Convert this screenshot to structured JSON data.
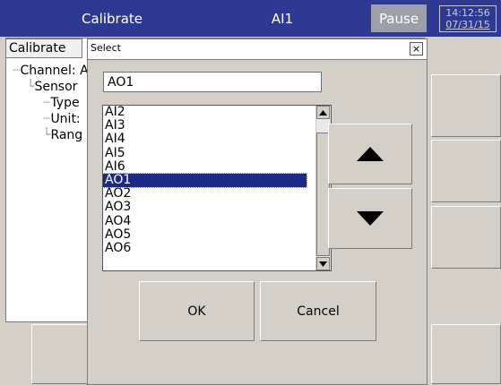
{
  "header": {
    "title": "Calibrate",
    "channel": "AI1",
    "status": "Pause",
    "time": "14:12:56",
    "date": "07/31/15",
    "background": "#2e3a92"
  },
  "tabs": {
    "calibrate": "Calibrate"
  },
  "tree": {
    "channel": "Channel: A",
    "sensor": "Sensor",
    "type": "Type",
    "unit": "Unit:",
    "range": "Rang"
  },
  "dialog": {
    "title": "Select",
    "close": "×",
    "input_value": "AO1",
    "items": [
      "AI2",
      "AI3",
      "AI4",
      "AI5",
      "AI6",
      "AO1",
      "AO2",
      "AO3",
      "AO4",
      "AO5",
      "AO6"
    ],
    "selected": "AO1",
    "selection_color": "#1b2b84",
    "up_icon": "up-arrow-icon",
    "down_icon": "down-arrow-icon",
    "ok": "OK",
    "cancel": "Cancel"
  }
}
